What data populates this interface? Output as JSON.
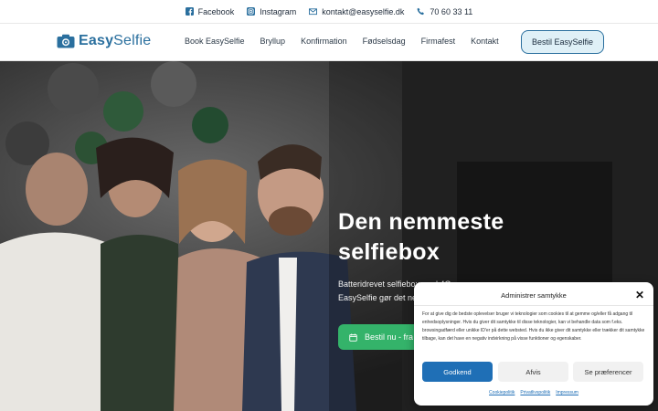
{
  "topbar": {
    "facebook": "Facebook",
    "instagram": "Instagram",
    "email": "kontakt@easyselfie.dk",
    "phone": "70 60 33 11"
  },
  "nav": {
    "logo": {
      "part1": "Easy",
      "part2": "Selfie"
    },
    "items": [
      {
        "label": "Book EasySelfie"
      },
      {
        "label": "Bryllup"
      },
      {
        "label": "Konfirmation"
      },
      {
        "label": "Fødselsdag"
      },
      {
        "label": "Firmafest"
      },
      {
        "label": "Kontakt"
      }
    ],
    "cta": "Bestil EasySelfie"
  },
  "hero": {
    "title": "Den nemmeste selfiebox",
    "subtitle_line1": "Batteridrevet selfiebox med 4G",
    "subtitle_line2": "EasySelfie gør det nemt",
    "button": "Bestil nu - fra"
  },
  "cookie": {
    "title": "Administrer samtykke",
    "body": "For at give dig de bedste oplevelser bruger vi teknologier som cookies til at gemme og/eller få adgang til enhedsoplysninger. Hvis du giver dit samtykke til disse teknologier, kan vi behandle data som f.eks. browsingadfærd eller unikke ID'er på dette websted. Hvis du ikke giver dit samtykke eller trækker dit samtykke tilbage, kan det have en negativ indvirkning på visse funktioner og egenskaber.",
    "accept": "Godkend",
    "deny": "Afvis",
    "preferences": "Se præferencer",
    "links": [
      "Cookiepolitik",
      "Privatlivspolitik",
      "Impressum"
    ]
  },
  "colors": {
    "brand": "#2a6f9e",
    "accent_green": "#34b36a",
    "accept_blue": "#1f6fb6"
  }
}
